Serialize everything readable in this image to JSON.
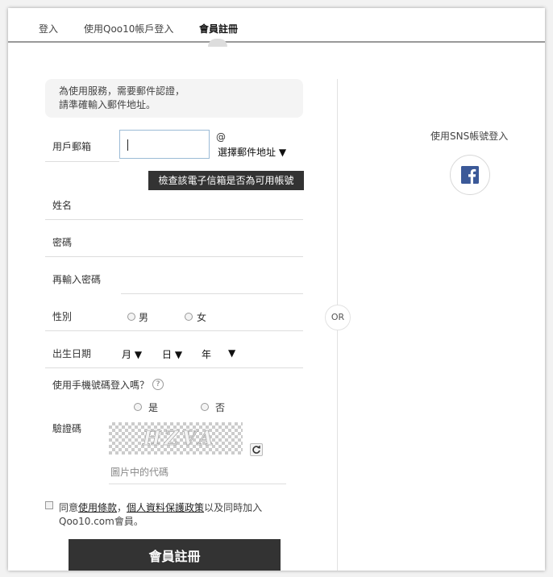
{
  "tabs": [
    {
      "label": "登入"
    },
    {
      "label": "使用Qoo10帳戶登入"
    },
    {
      "label": "會員註冊"
    }
  ],
  "notice": {
    "line1": "為使用服務，需要郵件認證，",
    "line2": "請準確輸入郵件地址。"
  },
  "form": {
    "email_label": "用戶郵箱",
    "email_value": "",
    "at_symbol": "@",
    "domain_select": "選擇郵件地址 ▼",
    "check_button": "檢查該電子信箱是否為可用帳號",
    "name_label": "姓名",
    "password_label": "密碼",
    "password_confirm_label": "再輸入密碼",
    "gender_label": "性別",
    "gender_male": "男",
    "gender_female": "女",
    "birth_label": "出生日期",
    "birth_month": "月 ▼",
    "birth_day": "日 ▼",
    "birth_year": "年",
    "birth_year_arrow": "▼",
    "phone_login_label": "使用手機號碼登入嗎？",
    "help_icon_text": "?",
    "phone_yes": "是",
    "phone_no": "否",
    "captcha_label": "驗證碼",
    "captcha_text": "HZVA",
    "captcha_placeholder": "圖片中的代碼",
    "agree_prefix": "同意",
    "agree_terms": "使用條款",
    "agree_sep": "，",
    "agree_privacy": "個人資料保護政策",
    "agree_suffix": "以及同時加入",
    "agree_line2": "Qoo10.com會員。",
    "submit_button": "會員註冊"
  },
  "or_text": "OR",
  "sns": {
    "title": "使用SNS帳號登入",
    "facebook_color": "#3b5998"
  }
}
